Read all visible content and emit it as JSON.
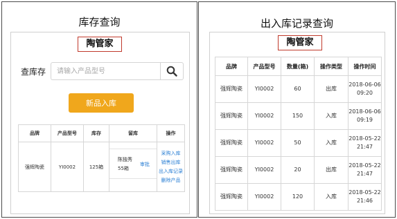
{
  "left_panel": {
    "title": "库存查询",
    "app_name": "陶管家",
    "search": {
      "label": "查库存",
      "placeholder": "请输入产品型号"
    },
    "add_button": "新品入库",
    "table": {
      "headers": [
        "品牌",
        "产品型号",
        "库存",
        "留库",
        "操作"
      ],
      "rows": [
        {
          "brand": "强辉陶瓷",
          "model": "YI0002",
          "stock": "125箱",
          "reserve_name": "陈独秀",
          "reserve_qty": "55箱",
          "reserve_action": "审批",
          "ops": [
            "采购入库",
            "销售出库",
            "出入库记录",
            "删除产品"
          ]
        }
      ]
    }
  },
  "right_panel": {
    "title": "出入库记录查询",
    "app_name": "陶管家",
    "table": {
      "headers": [
        "品牌",
        "产品型号",
        "数量(箱)",
        "操作类型",
        "操作时间"
      ],
      "rows": [
        {
          "brand": "强辉陶瓷",
          "model": "YI0002",
          "qty": "60",
          "type": "出库",
          "time": "2018-06-06 09:20"
        },
        {
          "brand": "强辉陶瓷",
          "model": "YI0002",
          "qty": "150",
          "type": "入库",
          "time": "2018-06-06 09:19"
        },
        {
          "brand": "强辉陶瓷",
          "model": "YI0002",
          "qty": "50",
          "type": "入库",
          "time": "2018-05-22 21:47"
        },
        {
          "brand": "强辉陶瓷",
          "model": "YI0002",
          "qty": "20",
          "type": "出库",
          "time": "2018-05-22 21:47"
        },
        {
          "brand": "强辉陶瓷",
          "model": "YI0002",
          "qty": "120",
          "type": "入库",
          "time": "2018-05-22 21:46"
        }
      ]
    }
  },
  "icons": {
    "search": "magnifier-icon"
  },
  "colors": {
    "accent": "#f0a71c",
    "link": "#2a7fd4",
    "app_name_border": "#c0392b"
  }
}
